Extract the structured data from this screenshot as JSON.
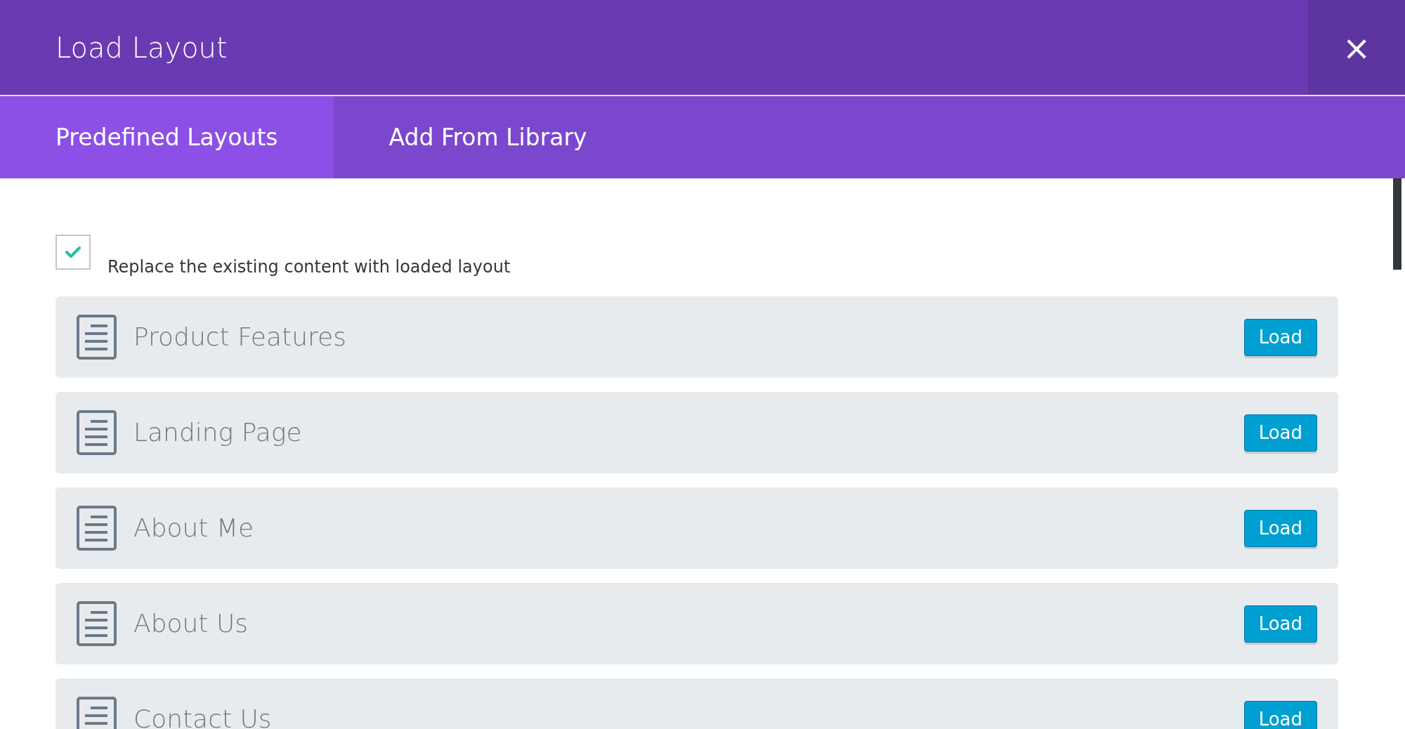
{
  "window": {
    "title": "Load Layout",
    "close": "×"
  },
  "tabs": [
    {
      "label": "Predefined Layouts",
      "selected": true
    },
    {
      "label": "Add From Library",
      "selected": false
    }
  ],
  "option": {
    "label": "Replace the existing content with loaded layout",
    "checked": true
  },
  "layouts": [
    {
      "name": "Product Features",
      "button": "Load"
    },
    {
      "name": "Landing Page",
      "button": "Load"
    },
    {
      "name": "About Me",
      "button": "Load"
    },
    {
      "name": "About Us",
      "button": "Load"
    },
    {
      "name": "Contact Us",
      "button": "Load"
    }
  ]
}
